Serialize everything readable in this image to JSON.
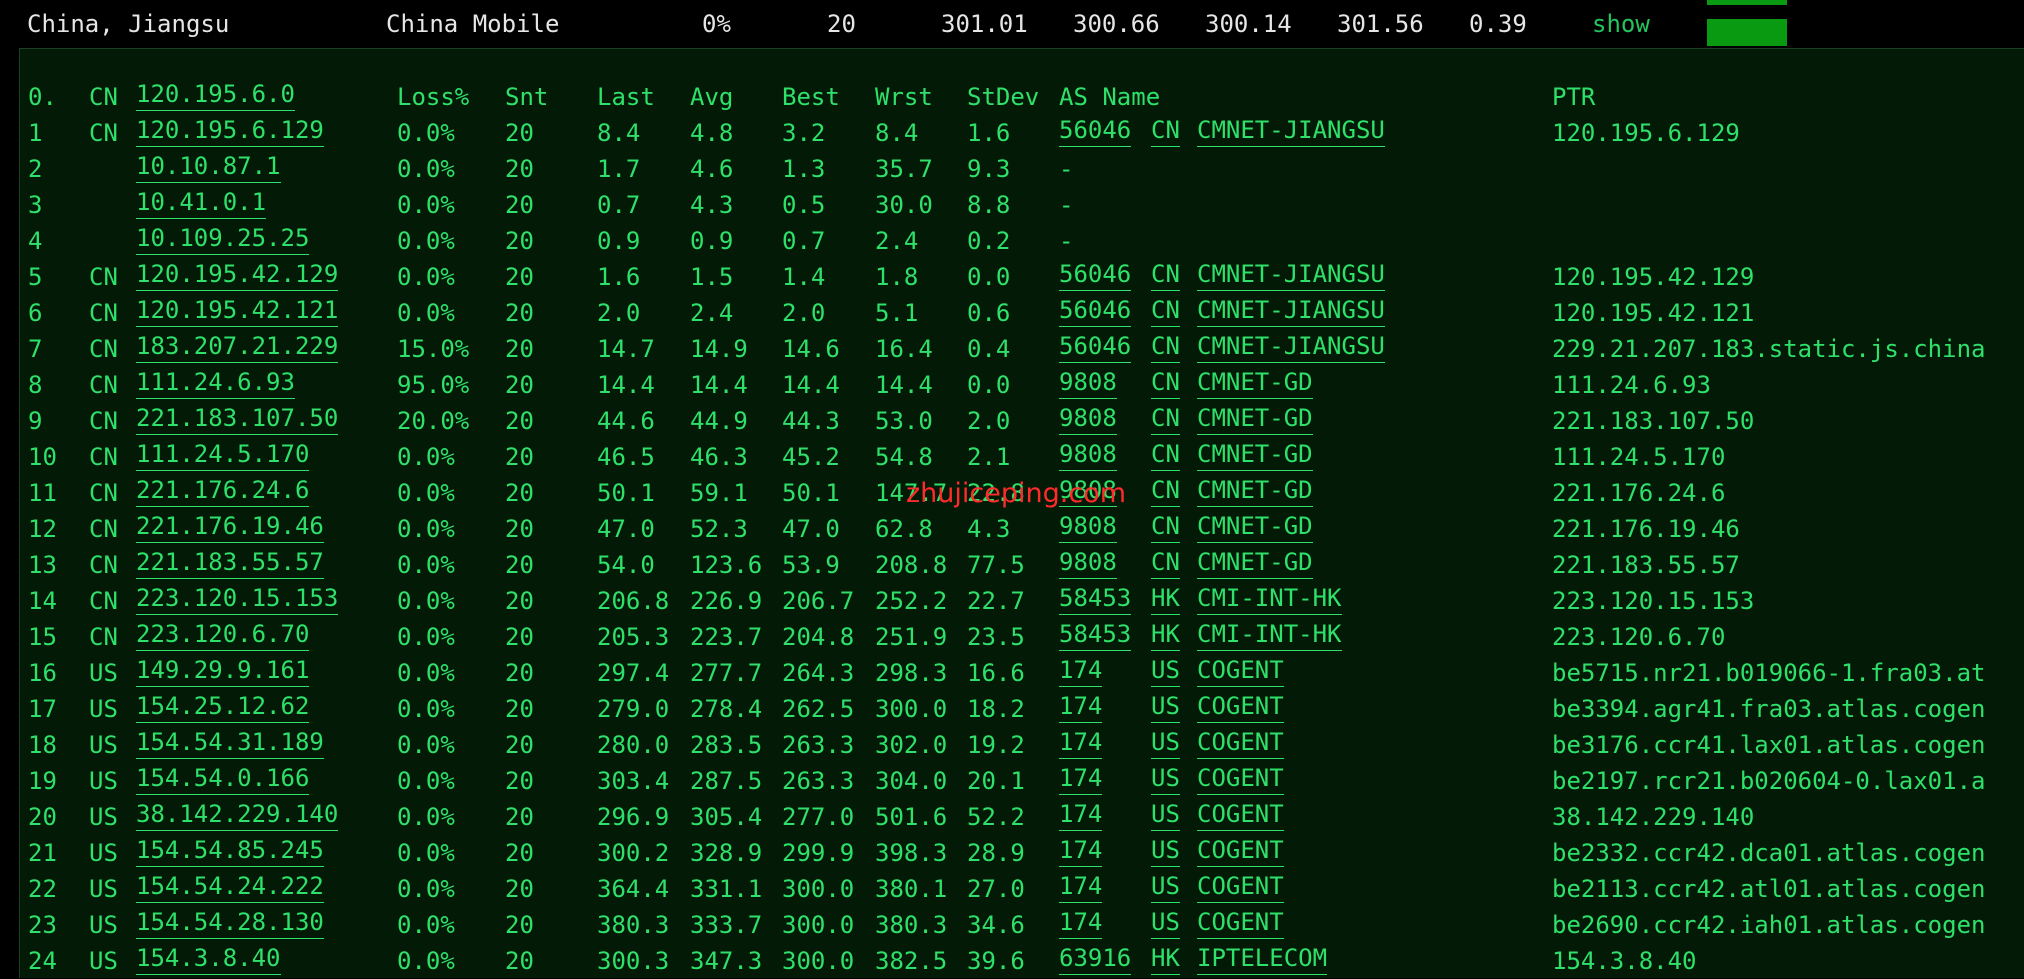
{
  "summary": {
    "location": "China, Jiangsu",
    "isp": "China Mobile",
    "loss": "0%",
    "sent": "20",
    "last": "301.01",
    "avg": "300.66",
    "best": "300.14",
    "worst": "301.56",
    "stdev": "0.39",
    "show_label": "show",
    "bar_color": "#0a9a12"
  },
  "watermark": "zhujiceping.com",
  "header": {
    "hop": "0.",
    "cc": "CN",
    "host": "120.195.6.0",
    "loss": "Loss%",
    "snt": "Snt",
    "last": "Last",
    "avg": "Avg",
    "best": "Best",
    "wrst": "Wrst",
    "stdev": "StDev",
    "as_name": "AS Name",
    "ptr": "PTR"
  },
  "hops": [
    {
      "hop": "1",
      "cc": "CN",
      "host": "120.195.6.129",
      "loss": "0.0%",
      "snt": "20",
      "last": "8.4",
      "avg": "4.8",
      "best": "3.2",
      "wrst": "8.4",
      "stdev": "1.6",
      "asn": "56046",
      "as_cc": "CN",
      "as_org": "CMNET-JIANGSU",
      "ptr": "120.195.6.129"
    },
    {
      "hop": "2",
      "cc": "",
      "host": "10.10.87.1",
      "loss": "0.0%",
      "snt": "20",
      "last": "1.7",
      "avg": "4.6",
      "best": "1.3",
      "wrst": "35.7",
      "stdev": "9.3",
      "asn": "-",
      "as_cc": "",
      "as_org": "",
      "ptr": ""
    },
    {
      "hop": "3",
      "cc": "",
      "host": "10.41.0.1",
      "loss": "0.0%",
      "snt": "20",
      "last": "0.7",
      "avg": "4.3",
      "best": "0.5",
      "wrst": "30.0",
      "stdev": "8.8",
      "asn": "-",
      "as_cc": "",
      "as_org": "",
      "ptr": ""
    },
    {
      "hop": "4",
      "cc": "",
      "host": "10.109.25.25",
      "loss": "0.0%",
      "snt": "20",
      "last": "0.9",
      "avg": "0.9",
      "best": "0.7",
      "wrst": "2.4",
      "stdev": "0.2",
      "asn": "-",
      "as_cc": "",
      "as_org": "",
      "ptr": ""
    },
    {
      "hop": "5",
      "cc": "CN",
      "host": "120.195.42.129",
      "loss": "0.0%",
      "snt": "20",
      "last": "1.6",
      "avg": "1.5",
      "best": "1.4",
      "wrst": "1.8",
      "stdev": "0.0",
      "asn": "56046",
      "as_cc": "CN",
      "as_org": "CMNET-JIANGSU",
      "ptr": "120.195.42.129"
    },
    {
      "hop": "6",
      "cc": "CN",
      "host": "120.195.42.121",
      "loss": "0.0%",
      "snt": "20",
      "last": "2.0",
      "avg": "2.4",
      "best": "2.0",
      "wrst": "5.1",
      "stdev": "0.6",
      "asn": "56046",
      "as_cc": "CN",
      "as_org": "CMNET-JIANGSU",
      "ptr": "120.195.42.121"
    },
    {
      "hop": "7",
      "cc": "CN",
      "host": "183.207.21.229",
      "loss": "15.0%",
      "snt": "20",
      "last": "14.7",
      "avg": "14.9",
      "best": "14.6",
      "wrst": "16.4",
      "stdev": "0.4",
      "asn": "56046",
      "as_cc": "CN",
      "as_org": "CMNET-JIANGSU",
      "ptr": "229.21.207.183.static.js.china"
    },
    {
      "hop": "8",
      "cc": "CN",
      "host": "111.24.6.93",
      "loss": "95.0%",
      "snt": "20",
      "last": "14.4",
      "avg": "14.4",
      "best": "14.4",
      "wrst": "14.4",
      "stdev": "0.0",
      "asn": "9808",
      "as_cc": "CN",
      "as_org": "CMNET-GD",
      "ptr": "111.24.6.93"
    },
    {
      "hop": "9",
      "cc": "CN",
      "host": "221.183.107.50",
      "loss": "20.0%",
      "snt": "20",
      "last": "44.6",
      "avg": "44.9",
      "best": "44.3",
      "wrst": "53.0",
      "stdev": "2.0",
      "asn": "9808",
      "as_cc": "CN",
      "as_org": "CMNET-GD",
      "ptr": "221.183.107.50"
    },
    {
      "hop": "10",
      "cc": "CN",
      "host": "111.24.5.170",
      "loss": "0.0%",
      "snt": "20",
      "last": "46.5",
      "avg": "46.3",
      "best": "45.2",
      "wrst": "54.8",
      "stdev": "2.1",
      "asn": "9808",
      "as_cc": "CN",
      "as_org": "CMNET-GD",
      "ptr": "111.24.5.170"
    },
    {
      "hop": "11",
      "cc": "CN",
      "host": "221.176.24.6",
      "loss": "0.0%",
      "snt": "20",
      "last": "50.1",
      "avg": "59.1",
      "best": "50.1",
      "wrst": "147.7",
      "stdev": "22.8",
      "asn": "9808",
      "as_cc": "CN",
      "as_org": "CMNET-GD",
      "ptr": "221.176.24.6"
    },
    {
      "hop": "12",
      "cc": "CN",
      "host": "221.176.19.46",
      "loss": "0.0%",
      "snt": "20",
      "last": "47.0",
      "avg": "52.3",
      "best": "47.0",
      "wrst": "62.8",
      "stdev": "4.3",
      "asn": "9808",
      "as_cc": "CN",
      "as_org": "CMNET-GD",
      "ptr": "221.176.19.46"
    },
    {
      "hop": "13",
      "cc": "CN",
      "host": "221.183.55.57",
      "loss": "0.0%",
      "snt": "20",
      "last": "54.0",
      "avg": "123.6",
      "best": "53.9",
      "wrst": "208.8",
      "stdev": "77.5",
      "asn": "9808",
      "as_cc": "CN",
      "as_org": "CMNET-GD",
      "ptr": "221.183.55.57"
    },
    {
      "hop": "14",
      "cc": "CN",
      "host": "223.120.15.153",
      "loss": "0.0%",
      "snt": "20",
      "last": "206.8",
      "avg": "226.9",
      "best": "206.7",
      "wrst": "252.2",
      "stdev": "22.7",
      "asn": "58453",
      "as_cc": "HK",
      "as_org": "CMI-INT-HK",
      "ptr": "223.120.15.153"
    },
    {
      "hop": "15",
      "cc": "CN",
      "host": "223.120.6.70",
      "loss": "0.0%",
      "snt": "20",
      "last": "205.3",
      "avg": "223.7",
      "best": "204.8",
      "wrst": "251.9",
      "stdev": "23.5",
      "asn": "58453",
      "as_cc": "HK",
      "as_org": "CMI-INT-HK",
      "ptr": "223.120.6.70"
    },
    {
      "hop": "16",
      "cc": "US",
      "host": "149.29.9.161",
      "loss": "0.0%",
      "snt": "20",
      "last": "297.4",
      "avg": "277.7",
      "best": "264.3",
      "wrst": "298.3",
      "stdev": "16.6",
      "asn": "174",
      "as_cc": "US",
      "as_org": "COGENT",
      "ptr": "be5715.nr21.b019066-1.fra03.at"
    },
    {
      "hop": "17",
      "cc": "US",
      "host": "154.25.12.62",
      "loss": "0.0%",
      "snt": "20",
      "last": "279.0",
      "avg": "278.4",
      "best": "262.5",
      "wrst": "300.0",
      "stdev": "18.2",
      "asn": "174",
      "as_cc": "US",
      "as_org": "COGENT",
      "ptr": "be3394.agr41.fra03.atlas.cogen"
    },
    {
      "hop": "18",
      "cc": "US",
      "host": "154.54.31.189",
      "loss": "0.0%",
      "snt": "20",
      "last": "280.0",
      "avg": "283.5",
      "best": "263.3",
      "wrst": "302.0",
      "stdev": "19.2",
      "asn": "174",
      "as_cc": "US",
      "as_org": "COGENT",
      "ptr": "be3176.ccr41.lax01.atlas.cogen"
    },
    {
      "hop": "19",
      "cc": "US",
      "host": "154.54.0.166",
      "loss": "0.0%",
      "snt": "20",
      "last": "303.4",
      "avg": "287.5",
      "best": "263.3",
      "wrst": "304.0",
      "stdev": "20.1",
      "asn": "174",
      "as_cc": "US",
      "as_org": "COGENT",
      "ptr": "be2197.rcr21.b020604-0.lax01.a"
    },
    {
      "hop": "20",
      "cc": "US",
      "host": "38.142.229.140",
      "loss": "0.0%",
      "snt": "20",
      "last": "296.9",
      "avg": "305.4",
      "best": "277.0",
      "wrst": "501.6",
      "stdev": "52.2",
      "asn": "174",
      "as_cc": "US",
      "as_org": "COGENT",
      "ptr": "38.142.229.140"
    },
    {
      "hop": "21",
      "cc": "US",
      "host": "154.54.85.245",
      "loss": "0.0%",
      "snt": "20",
      "last": "300.2",
      "avg": "328.9",
      "best": "299.9",
      "wrst": "398.3",
      "stdev": "28.9",
      "asn": "174",
      "as_cc": "US",
      "as_org": "COGENT",
      "ptr": "be2332.ccr42.dca01.atlas.cogen"
    },
    {
      "hop": "22",
      "cc": "US",
      "host": "154.54.24.222",
      "loss": "0.0%",
      "snt": "20",
      "last": "364.4",
      "avg": "331.1",
      "best": "300.0",
      "wrst": "380.1",
      "stdev": "27.0",
      "asn": "174",
      "as_cc": "US",
      "as_org": "COGENT",
      "ptr": "be2113.ccr42.atl01.atlas.cogen"
    },
    {
      "hop": "23",
      "cc": "US",
      "host": "154.54.28.130",
      "loss": "0.0%",
      "snt": "20",
      "last": "380.3",
      "avg": "333.7",
      "best": "300.0",
      "wrst": "380.3",
      "stdev": "34.6",
      "asn": "174",
      "as_cc": "US",
      "as_org": "COGENT",
      "ptr": "be2690.ccr42.iah01.atlas.cogen"
    },
    {
      "hop": "24",
      "cc": "US",
      "host": "154.3.8.40",
      "loss": "0.0%",
      "snt": "20",
      "last": "300.3",
      "avg": "347.3",
      "best": "300.0",
      "wrst": "382.5",
      "stdev": "39.6",
      "asn": "63916",
      "as_cc": "HK",
      "as_org": "IPTELECOM",
      "ptr": "154.3.8.40"
    }
  ]
}
